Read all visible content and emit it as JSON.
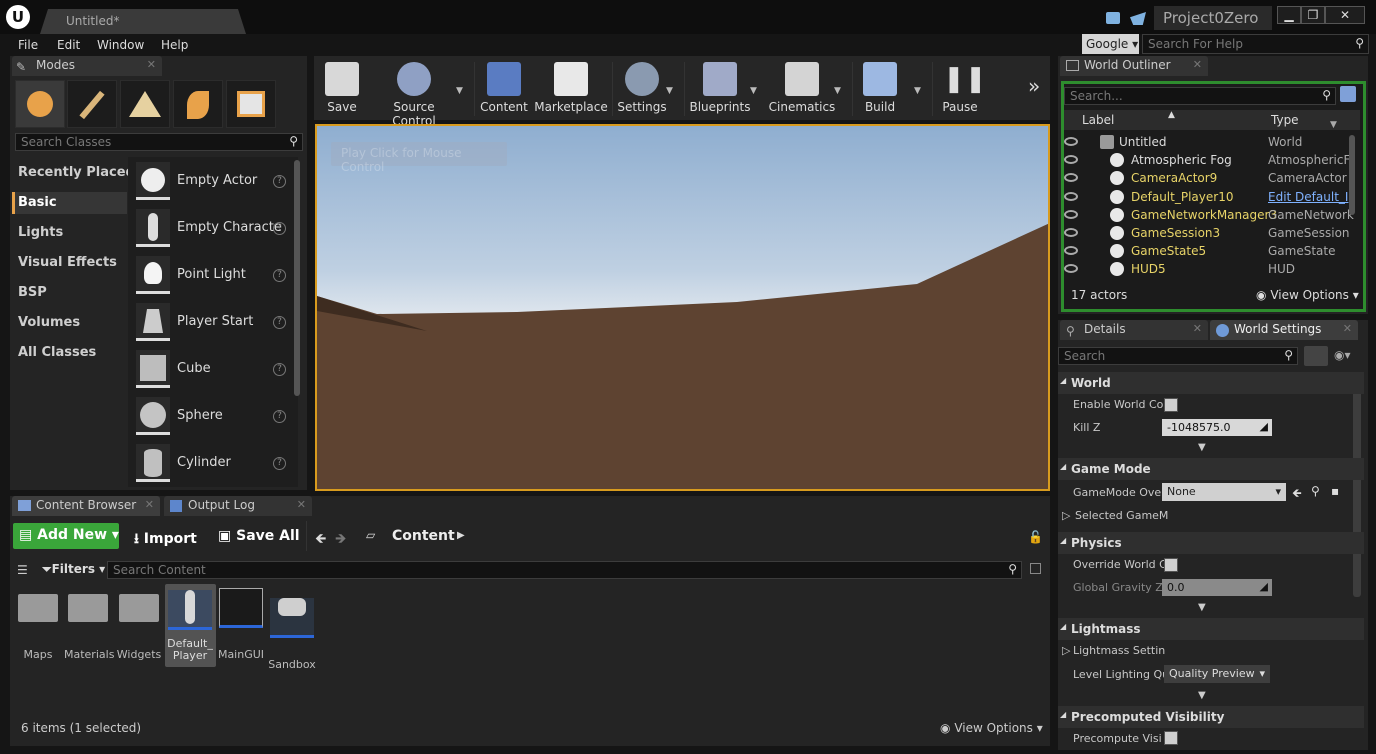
{
  "window": {
    "document_tab": "Untitled*",
    "project": "Project0Zero"
  },
  "menu": [
    "File",
    "Edit",
    "Window",
    "Help"
  ],
  "help": {
    "engine": "Google",
    "placeholder": "Search For Help"
  },
  "modes": {
    "tab": "Modes",
    "search_placeholder": "Search Classes",
    "categories": [
      "Recently Placed",
      "Basic",
      "Lights",
      "Visual Effects",
      "BSP",
      "Volumes",
      "All Classes"
    ],
    "active_category": "Basic",
    "items": [
      "Empty Actor",
      "Empty Characte",
      "Point Light",
      "Player Start",
      "Cube",
      "Sphere",
      "Cylinder"
    ]
  },
  "toolbar": {
    "items": [
      "Save",
      "Source Control",
      "Content",
      "Marketplace",
      "Settings",
      "Blueprints",
      "Cinematics",
      "Build",
      "Pause"
    ],
    "overflow": "»"
  },
  "viewport": {
    "hint": "Play Click for Mouse Control"
  },
  "outliner": {
    "tab": "World Outliner",
    "search_placeholder": "Search...",
    "col_label": "Label",
    "col_type": "Type",
    "rows": [
      {
        "label": "Untitled",
        "type": "World",
        "color": "#dddddd"
      },
      {
        "label": "Atmospheric Fog",
        "type": "AtmosphericF",
        "color": "#dddddd"
      },
      {
        "label": "CameraActor9",
        "type": "CameraActor",
        "color": "#e8d468"
      },
      {
        "label": "Default_Player10",
        "type": "Edit Default_I",
        "color": "#e8d468"
      },
      {
        "label": "GameNetworkManager3",
        "type": "GameNetwork",
        "color": "#e8d468"
      },
      {
        "label": "GameSession3",
        "type": "GameSession",
        "color": "#e8d468"
      },
      {
        "label": "GameState5",
        "type": "GameState",
        "color": "#e8d468"
      },
      {
        "label": "HUD5",
        "type": "HUD",
        "color": "#e8d468"
      }
    ],
    "count": "17 actors",
    "view_options": "View Options"
  },
  "details": {
    "tab_details": "Details",
    "tab_world": "World Settings",
    "search_placeholder": "Search",
    "sections": {
      "world": "World",
      "enable_world": "Enable World Cor",
      "kill_z_label": "Kill Z",
      "kill_z": "-1048575.0",
      "game_mode": "Game Mode",
      "gamemode_override": "GameMode Over",
      "gamemode_value": "None",
      "selected_gamemode": "Selected GameM",
      "physics": "Physics",
      "override_gravity": "Override World G",
      "global_gravity": "Global Gravity Z",
      "global_gravity_value": "0.0",
      "lightmass": "Lightmass",
      "lightmass_settings": "Lightmass Settin",
      "level_lighting": "Level Lighting Qu",
      "quality": "Quality Preview",
      "precomputed": "Precomputed Visibility",
      "precompute_vis": "Precompute Visi"
    }
  },
  "content_browser": {
    "tab": "Content Browser",
    "tab_output": "Output Log",
    "add_new": "Add New",
    "import": "Import",
    "save_all": "Save All",
    "path": "Content",
    "filters": "Filters",
    "search_placeholder": "Search Content",
    "assets": [
      {
        "name": "Maps",
        "kind": "folder"
      },
      {
        "name": "Materials",
        "kind": "folder"
      },
      {
        "name": "Widgets",
        "kind": "folder"
      },
      {
        "name": "Default_\nPlayer",
        "kind": "blueprint"
      },
      {
        "name": "MainGUI",
        "kind": "widget"
      },
      {
        "name": "Sandbox",
        "kind": "map"
      }
    ],
    "status": "6 items (1 selected)",
    "view_options": "View Options"
  }
}
